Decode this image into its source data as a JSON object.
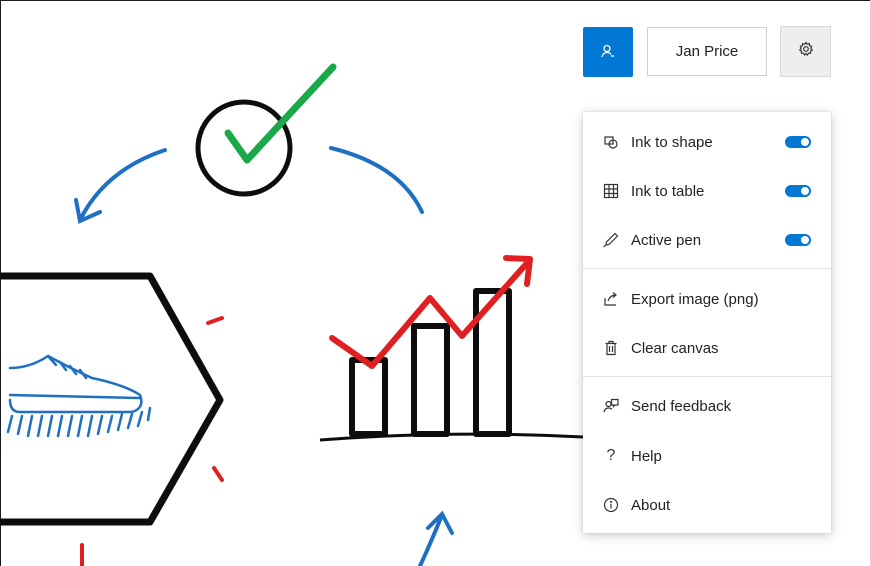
{
  "header": {
    "user_icon": "person-icon",
    "user_name": "Jan Price",
    "settings_icon": "gear-icon"
  },
  "menu": {
    "toggle_items": [
      {
        "label": "Ink to shape",
        "icon": "ink-shape-icon",
        "enabled": true
      },
      {
        "label": "Ink to table",
        "icon": "table-grid-icon",
        "enabled": true
      },
      {
        "label": "Active pen",
        "icon": "pen-icon",
        "enabled": true
      }
    ],
    "actions": [
      {
        "label": "Export image (png)",
        "icon": "export-icon"
      },
      {
        "label": "Clear canvas",
        "icon": "trash-icon"
      }
    ],
    "info": [
      {
        "label": "Send feedback",
        "icon": "feedback-icon"
      },
      {
        "label": "Help",
        "icon": "question-icon"
      },
      {
        "label": "About",
        "icon": "info-icon"
      }
    ]
  },
  "colors": {
    "accent": "#0078d4",
    "ink_black": "#0d0d0d",
    "ink_blue": "#1f6fc2",
    "ink_green": "#1aa94a",
    "ink_red": "#e02020"
  }
}
